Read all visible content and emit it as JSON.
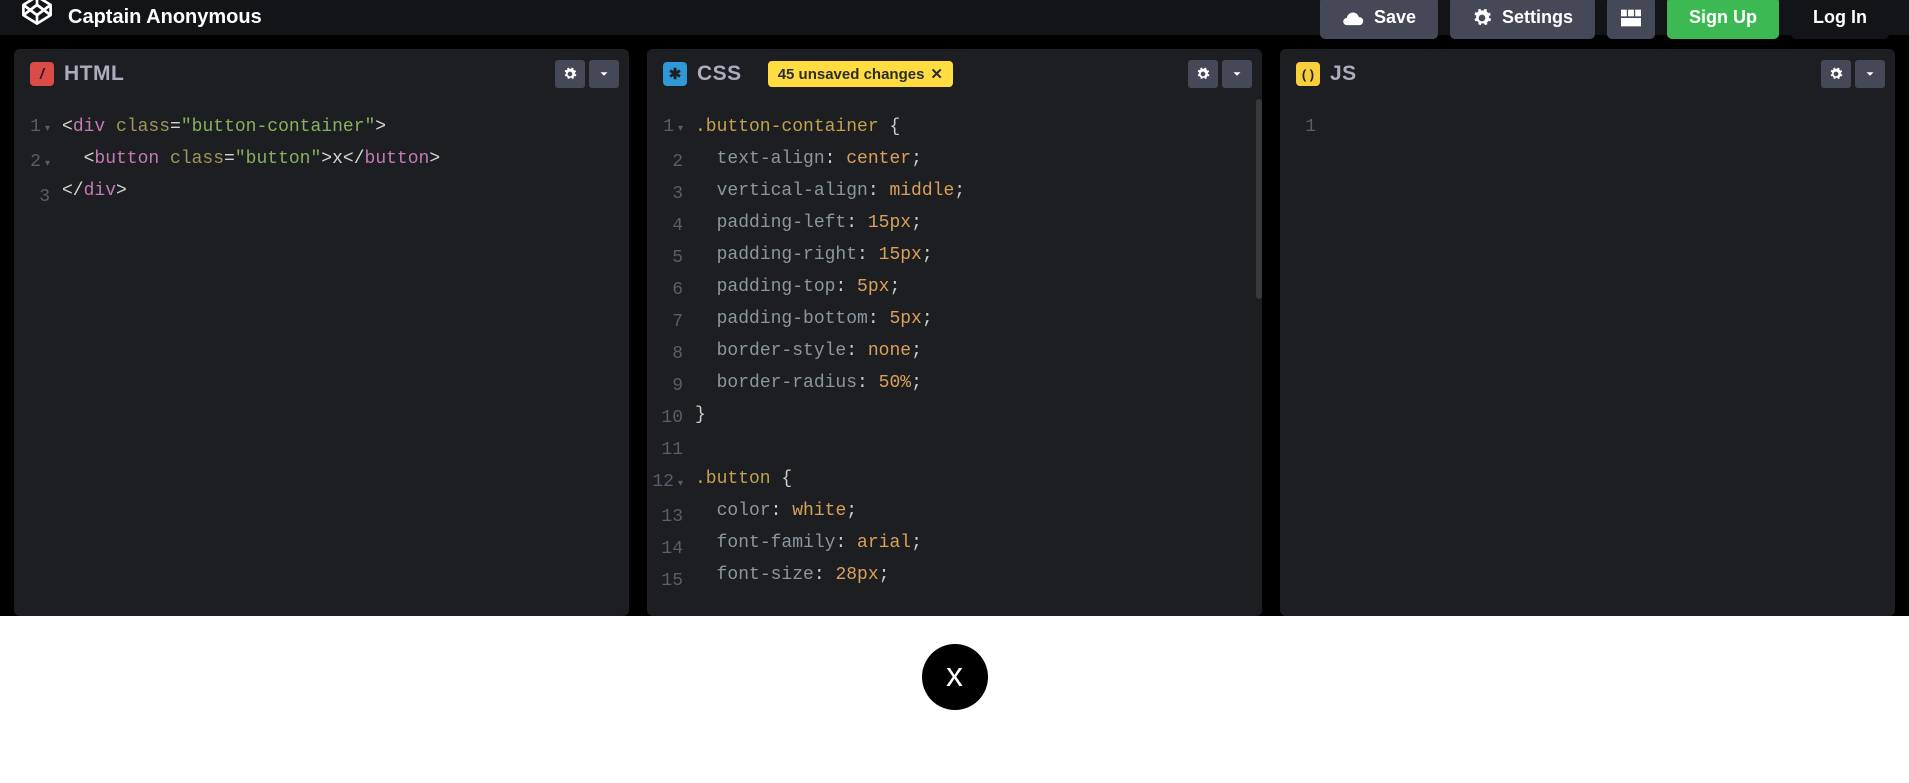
{
  "header": {
    "title": "Captain Anonymous",
    "save": "Save",
    "settings": "Settings",
    "signup": "Sign Up",
    "login": "Log In"
  },
  "panels": {
    "html": {
      "label": "HTML",
      "icon_color": "#dd4b49",
      "icon_glyph": "/",
      "lines": [
        "1",
        "2",
        "3"
      ],
      "code": [
        {
          "segments": [
            {
              "c": "t-txt",
              "t": "<"
            },
            {
              "c": "t-tag",
              "t": "div"
            },
            {
              "c": "t-txt",
              "t": " "
            },
            {
              "c": "t-attr",
              "t": "class"
            },
            {
              "c": "t-txt",
              "t": "="
            },
            {
              "c": "t-str",
              "t": "\"button-container\""
            },
            {
              "c": "t-txt",
              "t": ">"
            }
          ]
        },
        {
          "segments": [
            {
              "c": "t-txt",
              "t": "  <"
            },
            {
              "c": "t-tag",
              "t": "button"
            },
            {
              "c": "t-txt",
              "t": " "
            },
            {
              "c": "t-attr",
              "t": "class"
            },
            {
              "c": "t-txt",
              "t": "="
            },
            {
              "c": "t-str",
              "t": "\"button\""
            },
            {
              "c": "t-txt",
              "t": ">"
            },
            {
              "c": "t-txt",
              "t": "x"
            },
            {
              "c": "t-txt",
              "t": "</"
            },
            {
              "c": "t-tag",
              "t": "button"
            },
            {
              "c": "t-txt",
              "t": ">"
            }
          ]
        },
        {
          "segments": [
            {
              "c": "t-txt",
              "t": "</"
            },
            {
              "c": "t-tag",
              "t": "div"
            },
            {
              "c": "t-txt",
              "t": ">"
            }
          ]
        }
      ]
    },
    "css": {
      "label": "CSS",
      "icon_color": "#2e99d6",
      "icon_glyph": "*",
      "badge": "45 unsaved changes",
      "lines": [
        "1",
        "2",
        "3",
        "4",
        "5",
        "6",
        "7",
        "8",
        "9",
        "10",
        "11",
        "12",
        "13",
        "14",
        "15"
      ],
      "code": [
        {
          "segments": [
            {
              "c": "t-sel",
              "t": ".button-container"
            },
            {
              "c": "t-punct",
              "t": " {"
            }
          ]
        },
        {
          "segments": [
            {
              "c": "t-txt",
              "t": "  "
            },
            {
              "c": "t-prop",
              "t": "text-align"
            },
            {
              "c": "t-punct",
              "t": ": "
            },
            {
              "c": "t-val",
              "t": "center"
            },
            {
              "c": "t-punct",
              "t": ";"
            }
          ]
        },
        {
          "segments": [
            {
              "c": "t-txt",
              "t": "  "
            },
            {
              "c": "t-prop",
              "t": "vertical-align"
            },
            {
              "c": "t-punct",
              "t": ": "
            },
            {
              "c": "t-val",
              "t": "middle"
            },
            {
              "c": "t-punct",
              "t": ";"
            }
          ]
        },
        {
          "segments": [
            {
              "c": "t-txt",
              "t": "  "
            },
            {
              "c": "t-prop",
              "t": "padding-left"
            },
            {
              "c": "t-punct",
              "t": ": "
            },
            {
              "c": "t-val",
              "t": "15px"
            },
            {
              "c": "t-punct",
              "t": ";"
            }
          ]
        },
        {
          "segments": [
            {
              "c": "t-txt",
              "t": "  "
            },
            {
              "c": "t-prop",
              "t": "padding-right"
            },
            {
              "c": "t-punct",
              "t": ": "
            },
            {
              "c": "t-val",
              "t": "15px"
            },
            {
              "c": "t-punct",
              "t": ";"
            }
          ]
        },
        {
          "segments": [
            {
              "c": "t-txt",
              "t": "  "
            },
            {
              "c": "t-prop",
              "t": "padding-top"
            },
            {
              "c": "t-punct",
              "t": ": "
            },
            {
              "c": "t-val",
              "t": "5px"
            },
            {
              "c": "t-punct",
              "t": ";"
            }
          ]
        },
        {
          "segments": [
            {
              "c": "t-txt",
              "t": "  "
            },
            {
              "c": "t-prop",
              "t": "padding-bottom"
            },
            {
              "c": "t-punct",
              "t": ": "
            },
            {
              "c": "t-val",
              "t": "5px"
            },
            {
              "c": "t-punct",
              "t": ";"
            }
          ]
        },
        {
          "segments": [
            {
              "c": "t-txt",
              "t": "  "
            },
            {
              "c": "t-prop",
              "t": "border-style"
            },
            {
              "c": "t-punct",
              "t": ": "
            },
            {
              "c": "t-val",
              "t": "none"
            },
            {
              "c": "t-punct",
              "t": ";"
            }
          ]
        },
        {
          "segments": [
            {
              "c": "t-txt",
              "t": "  "
            },
            {
              "c": "t-prop",
              "t": "border-radius"
            },
            {
              "c": "t-punct",
              "t": ": "
            },
            {
              "c": "t-val",
              "t": "50%"
            },
            {
              "c": "t-punct",
              "t": ";"
            }
          ]
        },
        {
          "segments": [
            {
              "c": "t-punct",
              "t": "}"
            }
          ]
        },
        {
          "segments": [
            {
              "c": "t-txt",
              "t": " "
            }
          ]
        },
        {
          "segments": [
            {
              "c": "t-sel",
              "t": ".button"
            },
            {
              "c": "t-punct",
              "t": " {"
            }
          ]
        },
        {
          "segments": [
            {
              "c": "t-txt",
              "t": "  "
            },
            {
              "c": "t-prop",
              "t": "color"
            },
            {
              "c": "t-punct",
              "t": ": "
            },
            {
              "c": "t-val",
              "t": "white"
            },
            {
              "c": "t-punct",
              "t": ";"
            }
          ]
        },
        {
          "segments": [
            {
              "c": "t-txt",
              "t": "  "
            },
            {
              "c": "t-prop",
              "t": "font-family"
            },
            {
              "c": "t-punct",
              "t": ": "
            },
            {
              "c": "t-val",
              "t": "arial"
            },
            {
              "c": "t-punct",
              "t": ";"
            }
          ]
        },
        {
          "segments": [
            {
              "c": "t-txt",
              "t": "  "
            },
            {
              "c": "t-prop",
              "t": "font-size"
            },
            {
              "c": "t-punct",
              "t": ": "
            },
            {
              "c": "t-val",
              "t": "28px"
            },
            {
              "c": "t-punct",
              "t": ";"
            }
          ]
        }
      ]
    },
    "js": {
      "label": "JS",
      "icon_color": "#f7d039",
      "icon_glyph": "()",
      "lines": [
        "1"
      ],
      "code": [
        {
          "segments": [
            {
              "c": "t-txt",
              "t": " "
            }
          ]
        }
      ]
    }
  },
  "preview": {
    "button_text": "x"
  }
}
